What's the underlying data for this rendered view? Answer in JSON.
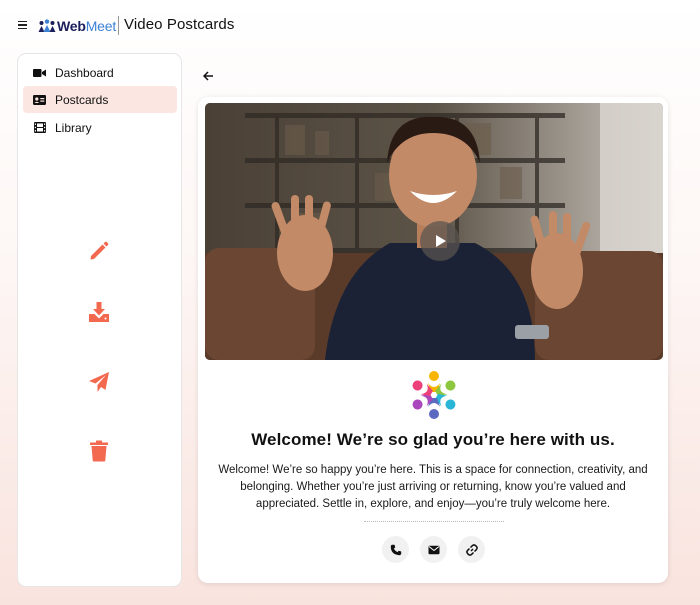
{
  "header": {
    "logo_web": "Web",
    "logo_meet": "Meet",
    "app_title": "Video Postcards",
    "menu_icon": "hamburger-menu-icon"
  },
  "sidebar": {
    "items": [
      {
        "label": "Dashboard",
        "icon": "video-camera-icon",
        "active": false
      },
      {
        "label": "Postcards",
        "icon": "id-card-icon",
        "active": true
      },
      {
        "label": "Library",
        "icon": "film-strip-icon",
        "active": false
      }
    ],
    "tools": [
      "pencil-icon",
      "download-icon",
      "send-icon",
      "trash-icon"
    ]
  },
  "colors": {
    "accent": "#f2694f",
    "active_bg": "#fbe6e2",
    "brand_navy": "#1b1f5c",
    "brand_blue": "#3b82d6"
  },
  "postcard": {
    "headline": "Welcome! We’re so glad you’re here with us.",
    "message": "Welcome! We’re so happy you’re here. This is a space for connection, creativity, and belonging. Whether you’re just arriving or returning, know you’re valued and appreciated. Settle in, explore, and enjoy—you’re truly welcome here.",
    "contacts": [
      "phone-icon",
      "email-icon",
      "link-icon"
    ]
  }
}
